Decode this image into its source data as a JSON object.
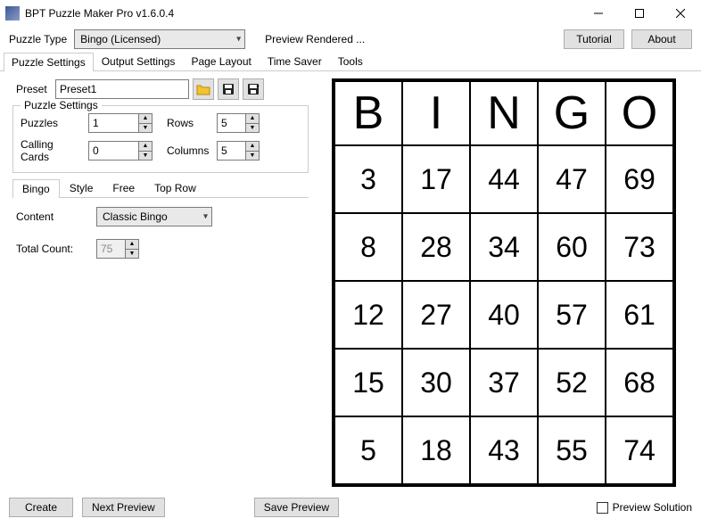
{
  "window": {
    "title": "BPT Puzzle Maker Pro v1.6.0.4"
  },
  "toprow": {
    "puzzle_type_label": "Puzzle Type",
    "puzzle_type_value": "Bingo (Licensed)",
    "preview_status": "Preview Rendered ...",
    "tutorial_btn": "Tutorial",
    "about_btn": "About"
  },
  "tabs": {
    "items": [
      "Puzzle Settings",
      "Output Settings",
      "Page Layout",
      "Time Saver",
      "Tools"
    ],
    "active": 0
  },
  "preset": {
    "label": "Preset",
    "value": "Preset1"
  },
  "puzzle_settings": {
    "legend": "Puzzle Settings",
    "puzzles_label": "Puzzles",
    "puzzles_value": "1",
    "rows_label": "Rows",
    "rows_value": "5",
    "calling_label": "Calling Cards",
    "calling_value": "0",
    "columns_label": "Columns",
    "columns_value": "5"
  },
  "subtabs": {
    "items": [
      "Bingo",
      "Style",
      "Free",
      "Top Row"
    ],
    "active": 0
  },
  "bingo_tab": {
    "content_label": "Content",
    "content_value": "Classic Bingo",
    "total_count_label": "Total Count:",
    "total_count_value": "75"
  },
  "card": {
    "headers": [
      "B",
      "I",
      "N",
      "G",
      "O"
    ],
    "rows": [
      [
        "3",
        "17",
        "44",
        "47",
        "69"
      ],
      [
        "8",
        "28",
        "34",
        "60",
        "73"
      ],
      [
        "12",
        "27",
        "40",
        "57",
        "61"
      ],
      [
        "15",
        "30",
        "37",
        "52",
        "68"
      ],
      [
        "5",
        "18",
        "43",
        "55",
        "74"
      ]
    ]
  },
  "bottom": {
    "create_btn": "Create",
    "next_preview_btn": "Next Preview",
    "save_preview_btn": "Save Preview",
    "preview_solution_label": "Preview Solution"
  }
}
